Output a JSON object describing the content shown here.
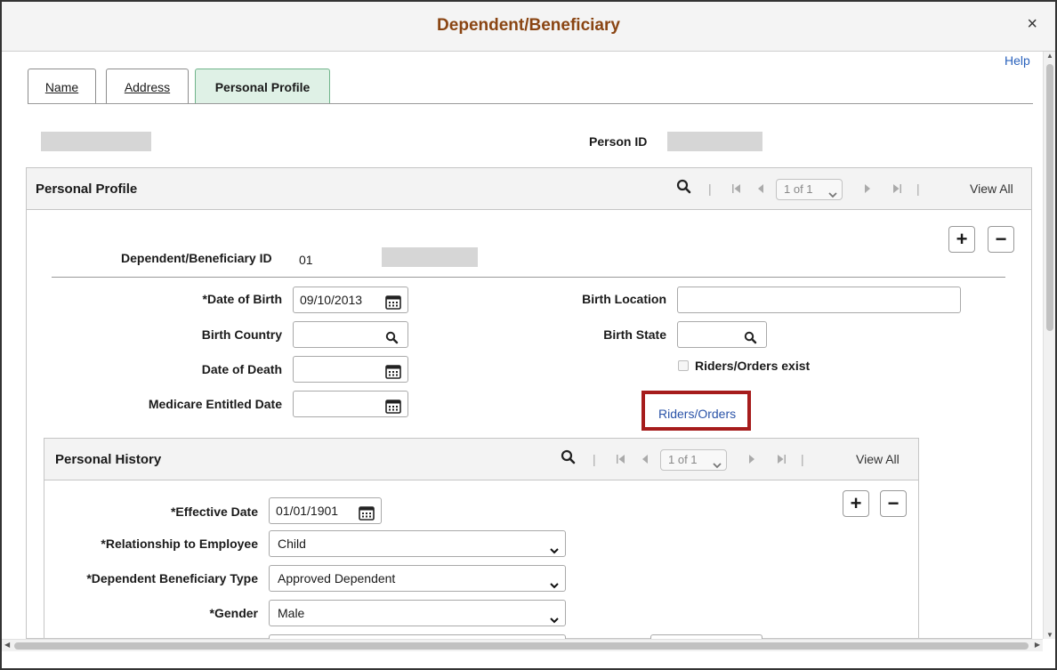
{
  "window": {
    "title": "Dependent/Beneficiary",
    "close_label": "×"
  },
  "help_label": "Help",
  "tabs": [
    {
      "label": "Name",
      "active": false
    },
    {
      "label": "Address",
      "active": false
    },
    {
      "label": "Personal Profile",
      "active": true
    }
  ],
  "header": {
    "person_id_label": "Person ID"
  },
  "personal_profile": {
    "title": "Personal Profile",
    "nav": {
      "separator": "|",
      "page": "1 of 1",
      "view_all": "View All"
    },
    "dep_id_label": "Dependent/Beneficiary ID",
    "dep_id_value": "01",
    "date_of_birth_label": "*Date of Birth",
    "date_of_birth_value": "09/10/2013",
    "birth_country_label": "Birth Country",
    "birth_country_value": "",
    "date_of_death_label": "Date of Death",
    "date_of_death_value": "",
    "medicare_label": "Medicare Entitled Date",
    "medicare_value": "",
    "birth_location_label": "Birth Location",
    "birth_location_value": "",
    "birth_state_label": "Birth State",
    "birth_state_value": "",
    "riders_exist_label": "Riders/Orders exist",
    "riders_exist_checked": false,
    "riders_link": "Riders/Orders"
  },
  "personal_history": {
    "title": "Personal History",
    "nav": {
      "separator": "|",
      "page": "1 of 1",
      "view_all": "View All"
    },
    "effective_date_label": "*Effective Date",
    "effective_date_value": "01/01/1901",
    "relationship_label": "*Relationship to Employee",
    "relationship_value": "Child",
    "dep_type_label": "*Dependent Beneficiary Type",
    "dep_type_value": "Approved Dependent",
    "gender_label": "*Gender",
    "gender_value": "Male"
  },
  "icons": {
    "search": "search-icon",
    "calendar": "calendar-icon",
    "chevron": "chevron-down-icon"
  },
  "colors": {
    "title": "#8a4513",
    "active_tab": "#dff1e6",
    "highlight": "#a61c1c",
    "link": "#2a53a8"
  }
}
